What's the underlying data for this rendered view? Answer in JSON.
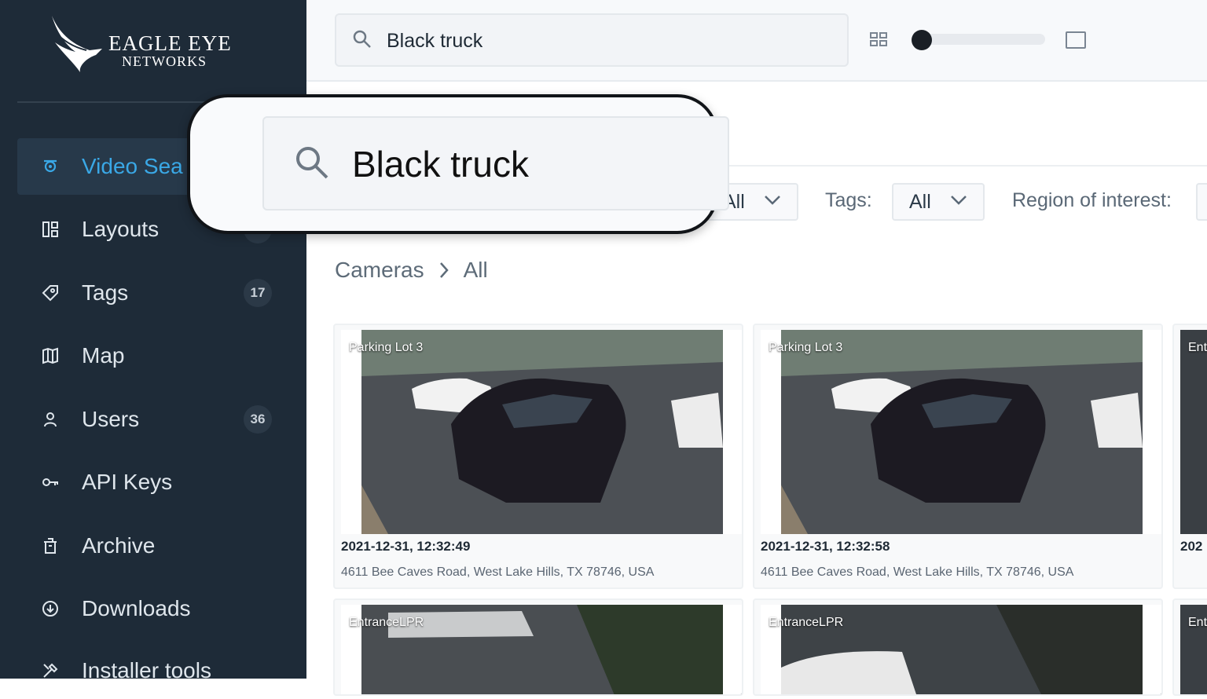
{
  "brand": {
    "line1": "EAGLE EYE",
    "line2": "NETWORKS"
  },
  "sidebar": {
    "items": [
      {
        "label": "Video Sea",
        "icon": "camera-icon",
        "active": true,
        "count": null
      },
      {
        "label": "Layouts",
        "icon": "layouts-icon",
        "count": "24"
      },
      {
        "label": "Tags",
        "icon": "tag-icon",
        "count": "17"
      },
      {
        "label": "Map",
        "icon": "map-icon",
        "count": null
      },
      {
        "label": "Users",
        "icon": "user-icon",
        "count": "36"
      },
      {
        "label": "API Keys",
        "icon": "key-icon",
        "count": null
      },
      {
        "label": "Archive",
        "icon": "archive-icon",
        "count": null
      },
      {
        "label": "Downloads",
        "icon": "download-icon",
        "count": null
      },
      {
        "label": "Installer tools",
        "icon": "tools-icon",
        "count": null
      }
    ]
  },
  "search": {
    "value": "Black truck",
    "zoom_value": "Black truck"
  },
  "view_controls": {
    "grid_icon": "grid-icon",
    "single_icon": "single-view-icon",
    "size_level": 0
  },
  "filters": {
    "first": {
      "value": "All"
    },
    "tags": {
      "label": "Tags:",
      "value": "All"
    },
    "region": {
      "label": "Region of interest:"
    }
  },
  "breadcrumb": {
    "root": "Cameras",
    "current": "All"
  },
  "results": [
    {
      "camera": "Parking Lot 3",
      "timestamp": "2021-12-31, 12:32:49",
      "address": "4611 Bee Caves Road, West Lake Hills, TX 78746, USA"
    },
    {
      "camera": "Parking Lot 3",
      "timestamp": "2021-12-31, 12:32:58",
      "address": "4611 Bee Caves Road, West Lake Hills, TX 78746, USA"
    },
    {
      "camera": "Ent",
      "timestamp": "202"
    },
    {
      "camera": "EntranceLPR"
    },
    {
      "camera": "EntranceLPR"
    },
    {
      "camera": "Ent"
    }
  ],
  "colors": {
    "sidebar_bg": "#1e2b38",
    "accent": "#3aa8e6"
  }
}
